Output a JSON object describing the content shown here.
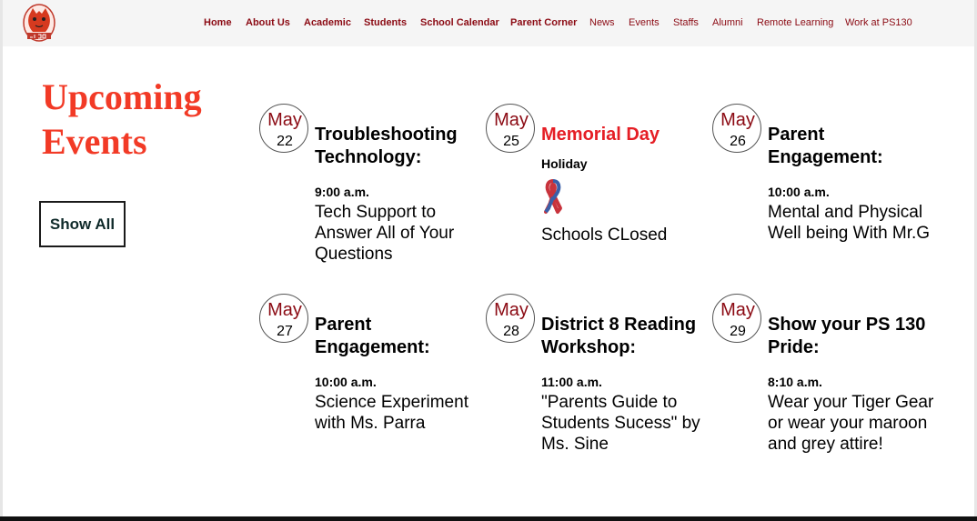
{
  "header": {
    "logo_icon": "ps130-tiger-logo-icon",
    "nav": [
      {
        "label": "Home",
        "bold": true
      },
      {
        "label": "About Us",
        "bold": true
      },
      {
        "label": "Academic",
        "bold": true
      },
      {
        "label": "Students",
        "bold": true
      },
      {
        "label": "School Calendar",
        "bold": true
      },
      {
        "label": "Parent Corner",
        "bold": true
      },
      {
        "label": "News",
        "bold": false
      },
      {
        "label": "Events",
        "bold": false
      },
      {
        "label": "Staffs",
        "bold": false
      },
      {
        "label": "Alumni",
        "bold": false
      },
      {
        "label": "Remote Learning",
        "bold": false
      },
      {
        "label": "Work at PS130",
        "bold": false
      }
    ]
  },
  "section": {
    "title": "Upcoming Events",
    "show_all_label": "Show All"
  },
  "events": [
    {
      "month": "May",
      "day": "22",
      "title": "Troubleshooting Technology:",
      "time": "9:00 a.m.",
      "description": "Tech Support to Answer All of Your Questions"
    },
    {
      "month": "May",
      "day": "25",
      "title": "Memorial Day",
      "subtitle": "Holiday",
      "icon": "ribbon-icon",
      "description": "Schools CLosed"
    },
    {
      "month": "May",
      "day": "26",
      "title": "Parent Engagement:",
      "time": "10:00 a.m.",
      "description": "Mental and Physical Well being With Mr.G"
    },
    {
      "month": "May",
      "day": "27",
      "title": "Parent Engagement:",
      "time": "10:00 a.m.",
      "description": "Science Experiment with Ms. Parra"
    },
    {
      "month": "May",
      "day": "28",
      "title": "District 8 Reading Workshop:",
      "time": "11:00 a.m.",
      "description": "\"Parents Guide to Students Sucess\" by Ms. Sine"
    },
    {
      "month": "May",
      "day": "29",
      "title": "Show your PS 130 Pride:",
      "time": "8:10 a.m.",
      "description": "Wear your Tiger Gear or wear your maroon and grey attire!"
    }
  ],
  "colors": {
    "nav_text": "#8b0a13",
    "title": "#f23a26",
    "month": "#8b0a13",
    "holiday_title": "#e51e25",
    "header_bg": "#f5f5f5"
  }
}
